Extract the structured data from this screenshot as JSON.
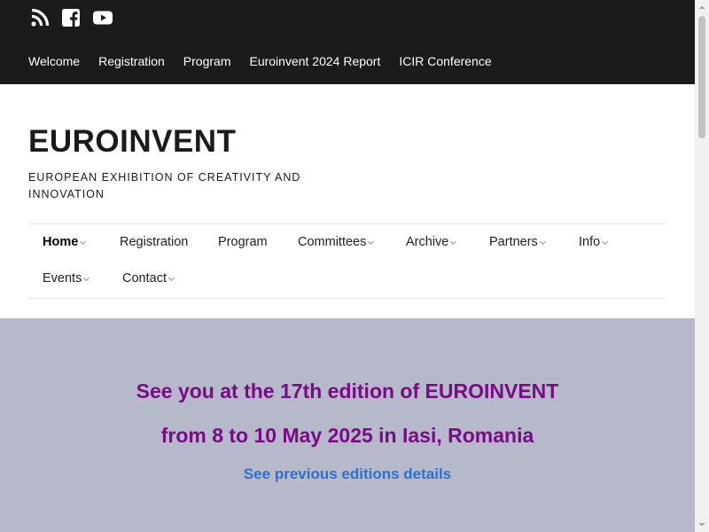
{
  "social": {
    "icons": [
      "rss-icon",
      "facebook-icon",
      "youtube-icon"
    ]
  },
  "topnav": {
    "items": [
      "Welcome",
      "Registration",
      "Program",
      "Euroinvent 2024 Report",
      "ICIR Conference"
    ]
  },
  "header": {
    "title": "EUROINVENT",
    "tagline": "EUROPEAN EXHIBITION OF CREATIVITY AND INNOVATION"
  },
  "mainnav": {
    "items": [
      {
        "label": "Home",
        "active": true,
        "dropdown": true
      },
      {
        "label": "Registration",
        "active": false,
        "dropdown": false
      },
      {
        "label": "Program",
        "active": false,
        "dropdown": false
      },
      {
        "label": "Committees",
        "active": false,
        "dropdown": true
      },
      {
        "label": "Archive",
        "active": false,
        "dropdown": true
      },
      {
        "label": "Partners",
        "active": false,
        "dropdown": true
      },
      {
        "label": "Info",
        "active": false,
        "dropdown": true
      },
      {
        "label": "Events",
        "active": false,
        "dropdown": true
      },
      {
        "label": "Contact",
        "active": false,
        "dropdown": true
      }
    ]
  },
  "hero": {
    "line1": "See you at the 17th edition of EUROINVENT",
    "line2": "from 8 to 10 May 2025 in Iasi, Romania",
    "link": "See previous editions details"
  },
  "colors": {
    "topbar_bg": "#1b1b1b",
    "hero_bg": "#b5b9ca",
    "hero_text": "#7b0a86",
    "link": "#2f6fd0"
  }
}
